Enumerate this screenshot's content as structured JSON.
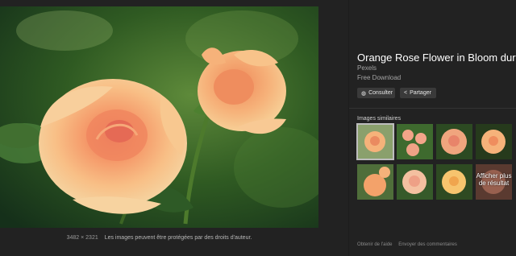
{
  "image": {
    "dimensions": "3482 × 2321",
    "notice": "Les images peuvent être protégées par des droits d'auteur."
  },
  "panel": {
    "title": "Orange Rose Flower in Bloom during",
    "source": "Pexels",
    "license": "Free Download",
    "visit_button": "Consulter",
    "share_button": "Partager",
    "visit_icon": "globe-icon",
    "share_icon": "share-icon",
    "similar_label": "Images similaires",
    "more_text": "Afficher plus de résultat"
  },
  "footer": {
    "help": "Obtenir de l'aide",
    "feedback": "Envoyer des commentaires"
  },
  "colors": {
    "background": "#222222",
    "button": "#3a3a3a",
    "rose_petal": "#f6b27a",
    "leaf_green": "#3e6a2e"
  }
}
